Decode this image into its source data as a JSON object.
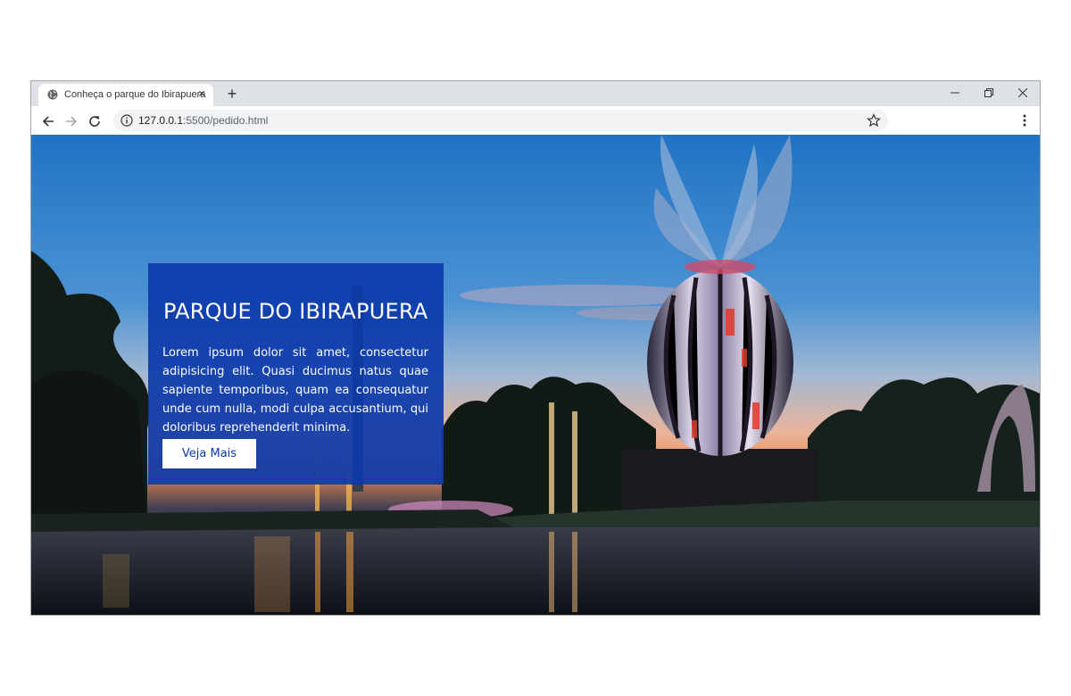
{
  "browser": {
    "tab_title": "Conheça o parque do Ibirapuera",
    "tab_close": "×",
    "new_tab": "+",
    "url_host": "127.0.0.1",
    "url_path": ":5500/pedido.html"
  },
  "hero": {
    "title": "PARQUE DO IBIRAPUERA",
    "text": "Lorem ipsum dolor sit amet, consectetur adipisicing elit. Quasi ducimus natus quae sapiente temporibus, quam ea consequatur unde cum nulla, modi culpa accusantium, qui doloribus reprehenderit minima.",
    "button_label": "Veja Mais",
    "card_color": "#0c39aa"
  }
}
